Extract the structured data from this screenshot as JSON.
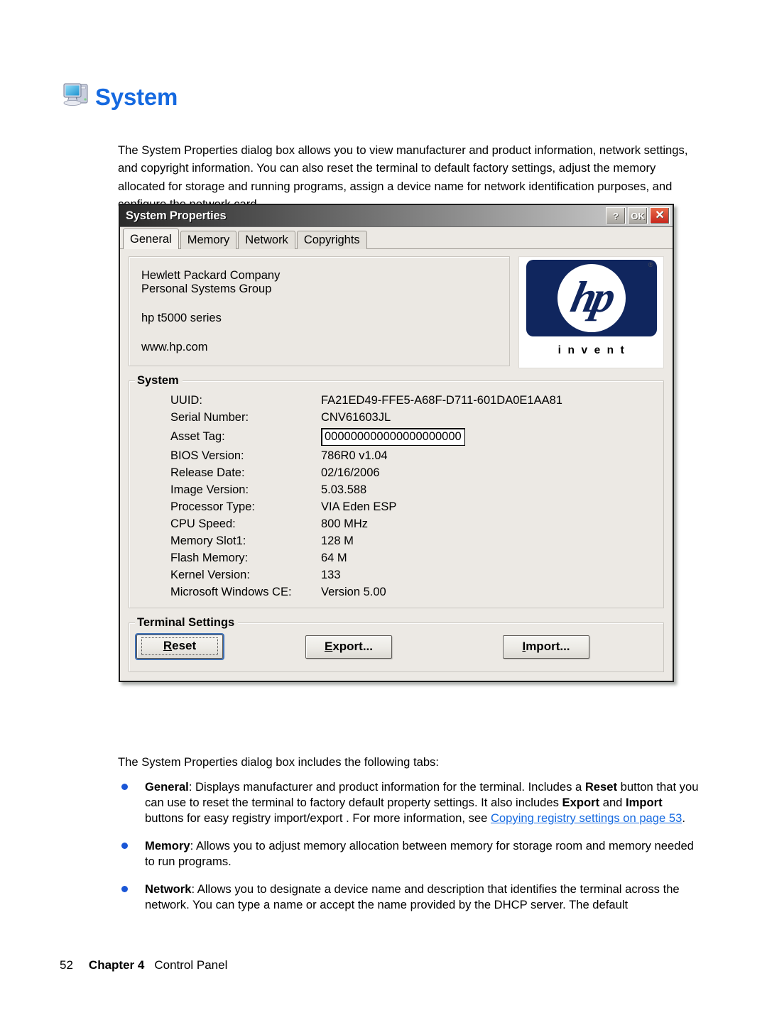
{
  "page": {
    "heading": "System",
    "heading_icon": "my-computer-icon",
    "heading_color": "#1569e0",
    "intro_paragraph": "The System Properties dialog box allows you to view manufacturer and product information, network settings, and copyright information. You can also reset the terminal to default factory settings, adjust the memory allocated for storage and running programs, assign a device name for network identification purposes, and configure the network card.",
    "lower_intro": "The System Properties dialog box includes the following tabs:"
  },
  "dialog": {
    "title": "System Properties",
    "titlebar_buttons": [
      {
        "name": "help-button",
        "label": "?"
      },
      {
        "name": "ok-button",
        "label": "OK"
      },
      {
        "name": "close-button",
        "label": "✕"
      }
    ],
    "tabs": [
      {
        "label": "General",
        "active": true
      },
      {
        "label": "Memory",
        "active": false
      },
      {
        "label": "Network",
        "active": false
      },
      {
        "label": "Copyrights",
        "active": false
      }
    ],
    "identity": {
      "company": "Hewlett Packard Company",
      "division": "Personal Systems Group",
      "product": "hp t5000 series",
      "website": "www.hp.com"
    },
    "logo": {
      "wordmark": "hp",
      "tagline": "invent",
      "registered_mark": "®",
      "badge_color": "#10265e"
    },
    "system_group": {
      "title": "System",
      "rows": [
        {
          "label": "UUID:",
          "value": "FA21ED49-FFE5-A68F-D711-601DA0E1AA81",
          "type": "text"
        },
        {
          "label": "Serial Number:",
          "value": "CNV61603JL",
          "type": "text"
        },
        {
          "label": "Asset Tag:",
          "value": "000000000000000000000",
          "type": "input"
        },
        {
          "label": "BIOS Version:",
          "value": "786R0 v1.04",
          "type": "text"
        },
        {
          "label": "Release Date:",
          "value": "02/16/2006",
          "type": "text"
        },
        {
          "label": "Image Version:",
          "value": "5.03.588",
          "type": "text"
        },
        {
          "label": "Processor Type:",
          "value": "VIA Eden ESP",
          "type": "text"
        },
        {
          "label": "CPU Speed:",
          "value": "800 MHz",
          "type": "text"
        },
        {
          "label": "Memory Slot1:",
          "value": "128 M",
          "type": "text"
        },
        {
          "label": "Flash Memory:",
          "value": "64 M",
          "type": "text"
        },
        {
          "label": "Kernel Version:",
          "value": "133",
          "type": "text"
        },
        {
          "label": "Microsoft Windows CE:",
          "value": "Version 5.00",
          "type": "text"
        }
      ]
    },
    "terminal_settings": {
      "title": "Terminal Settings",
      "buttons": [
        {
          "name": "reset-button",
          "accel": "R",
          "rest": "eset",
          "default": true
        },
        {
          "name": "export-button",
          "accel": "E",
          "rest": "xport...",
          "default": false
        },
        {
          "name": "import-button",
          "accel": "I",
          "rest": "mport...",
          "default": false
        }
      ]
    }
  },
  "bullets": [
    {
      "term": "General",
      "text_before": ": Displays manufacturer and product information for the terminal. Includes a ",
      "bold_1": "Reset",
      "text_mid_1": " button that you can use to reset the terminal to factory default property settings. It also includes ",
      "bold_2": "Export",
      "text_mid_2": " and ",
      "bold_3": "Import",
      "text_mid_3": " buttons for easy registry import/export . For more information, see ",
      "link": "Copying registry settings on page 53",
      "text_after": "."
    },
    {
      "term": "Memory",
      "text": ": Allows you to adjust memory allocation between memory for storage room and memory needed to run programs."
    },
    {
      "term": "Network",
      "text": ": Allows you to designate a device name and description that identifies the terminal across the network. You can type a name or accept the name provided by the DHCP server. The default"
    }
  ],
  "footer": {
    "page_number": "52",
    "chapter": "Chapter 4",
    "section": "Control Panel"
  }
}
